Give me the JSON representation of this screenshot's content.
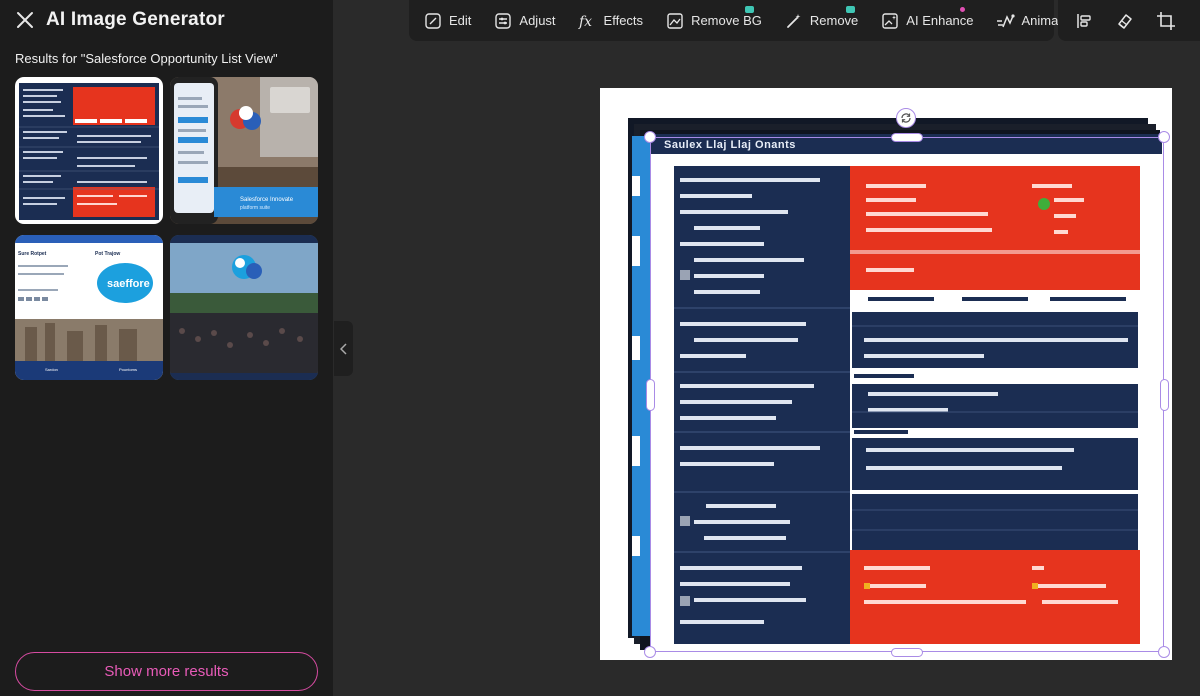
{
  "panel": {
    "title": "AI Image Generator",
    "results_label": "Results for \"Salesforce Opportunity List View\"",
    "show_more": "Show more results"
  },
  "thumbnails": [
    {
      "id": "result-1",
      "theme": "report"
    },
    {
      "id": "result-2",
      "theme": "phone",
      "caption": "Salesforce Innovate"
    },
    {
      "id": "result-3",
      "theme": "city",
      "logo": "saeffore",
      "nav": [
        "Sardon",
        "Pountoms"
      ]
    },
    {
      "id": "result-4",
      "theme": "crowd"
    }
  ],
  "toolbar": {
    "tools": [
      {
        "key": "edit",
        "label": "Edit",
        "icon": "edit-icon"
      },
      {
        "key": "adjust",
        "label": "Adjust",
        "icon": "adjust-icon"
      },
      {
        "key": "effects",
        "label": "Effects",
        "icon": "fx-icon"
      },
      {
        "key": "remove_bg",
        "label": "Remove BG",
        "icon": "remove-bg-icon",
        "badge": true
      },
      {
        "key": "remove",
        "label": "Remove",
        "icon": "magic-wand-icon",
        "badge": true
      },
      {
        "key": "ai_enhance",
        "label": "AI Enhance",
        "icon": "ai-enhance-icon",
        "dot": true
      },
      {
        "key": "animation",
        "label": "Animation",
        "icon": "animation-icon"
      }
    ],
    "right": [
      "align-icon",
      "eraser-icon",
      "crop-icon"
    ]
  },
  "colors": {
    "accent": "#e85bb8",
    "selection": "#a98be6",
    "panel_bg": "#1c1c1c",
    "canvas_bg": "#2a2a2a",
    "navy": "#1b2d52",
    "red": "#e6341e",
    "badge": "#3fc6b4"
  }
}
